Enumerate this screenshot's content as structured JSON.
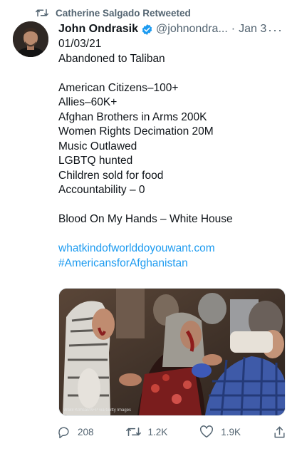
{
  "retweet": {
    "label": "Catherine Salgado Retweeted",
    "icon": "retweet-icon"
  },
  "author": {
    "name": "John Ondrasik",
    "handle": "@johnondra...",
    "separator": "·",
    "date": "Jan 3",
    "verified_icon": "verified-badge-icon",
    "verified_color": "#1d9bf0",
    "more_label": "···"
  },
  "tweet": {
    "lines": [
      "01/03/21",
      "Abandoned to Taliban",
      "",
      "American Citizens–100+",
      "Allies–60K+",
      "Afghan Brothers in Arms 200K",
      "Women Rights Decimation 20M",
      "Music Outlawed",
      "LGBTQ hunted",
      "Children sold for food",
      "Accountability – 0",
      "",
      "Blood On My Hands – White House",
      ""
    ],
    "link": "whatkindofworlddoyouwant.com",
    "hashtag": "#AmericansforAfghanistan",
    "link_color": "#1d9bf0"
  },
  "media": {
    "credit": "Wakil Kohsar/AFP via Getty Images"
  },
  "actions": {
    "reply": {
      "icon": "reply-icon",
      "count": "208"
    },
    "retweet": {
      "icon": "retweet-icon",
      "count": "1.2K"
    },
    "like": {
      "icon": "heart-icon",
      "count": "1.9K"
    },
    "share": {
      "icon": "share-icon"
    }
  }
}
